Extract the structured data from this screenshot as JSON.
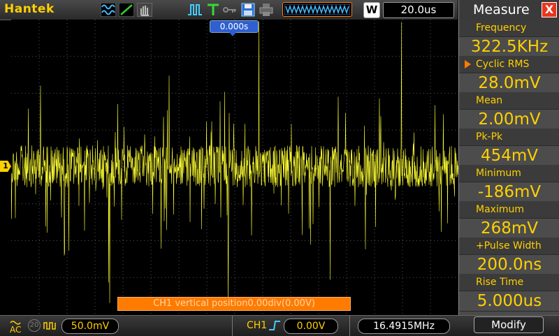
{
  "topbar": {
    "brand": "Hantek",
    "timebase": "20.0us",
    "w_label": "W",
    "icons": [
      "waveform-icon",
      "ramp-icon",
      "hand-icon",
      "run-icon",
      "trigger-icon",
      "key-icon",
      "save-icon",
      "print-icon",
      "memory-depth-icon"
    ]
  },
  "screen": {
    "time_position": "0.000s",
    "ch1_marker": "1",
    "vertical_position_msg": "CH1 vertical position0.00div(0.00V)"
  },
  "bottombar": {
    "coupling": "AC",
    "bw_label": "20",
    "ch1_volts_div": "50.0mV",
    "trigger_source": "CH1",
    "trigger_level": "0.00V",
    "trigger_freq": "16.4915MHz"
  },
  "sidebar": {
    "title": "Measure",
    "close": "X",
    "measurements": [
      {
        "label": "Frequency",
        "value": "322.5KHz"
      },
      {
        "label": "Cyclic RMS",
        "value": "28.0mV"
      },
      {
        "label": "Mean",
        "value": "2.00mV"
      },
      {
        "label": "Pk-Pk",
        "value": "454mV"
      },
      {
        "label": "Minimum",
        "value": "-186mV"
      },
      {
        "label": "Maximum",
        "value": "268mV"
      },
      {
        "label": "+Pulse Width",
        "value": "200.0ns"
      },
      {
        "label": "Rise Time",
        "value": "5.000us"
      }
    ],
    "modify": "Modify"
  },
  "colors": {
    "trace": "#ffff33",
    "accent": "#ffd000",
    "message": "#ff7b00"
  }
}
